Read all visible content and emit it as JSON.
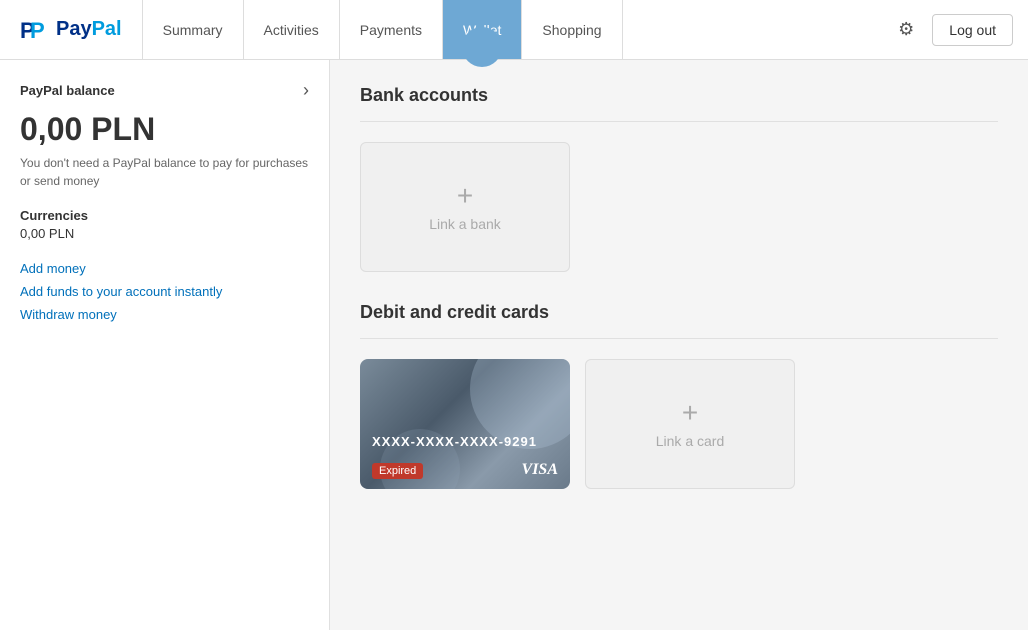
{
  "header": {
    "logo_text": "PayPal",
    "nav": [
      {
        "id": "summary",
        "label": "Summary",
        "active": false
      },
      {
        "id": "activities",
        "label": "Activities",
        "active": false
      },
      {
        "id": "payments",
        "label": "Payments",
        "active": false
      },
      {
        "id": "wallet",
        "label": "Wallet",
        "active": true
      },
      {
        "id": "shopping",
        "label": "Shopping",
        "active": false
      }
    ],
    "logout_label": "Log out"
  },
  "sidebar": {
    "balance_title": "PayPal balance",
    "balance_amount": "0,00 PLN",
    "balance_note": "You don't need a PayPal balance to pay for purchases or send money",
    "currencies_title": "Currencies",
    "currencies_value": "0,00 PLN",
    "links": [
      {
        "id": "add-money",
        "label": "Add money"
      },
      {
        "id": "add-funds",
        "label": "Add funds to your account instantly"
      },
      {
        "id": "withdraw",
        "label": "Withdraw money"
      }
    ]
  },
  "content": {
    "bank_section_title": "Bank accounts",
    "link_bank_label": "Link a bank",
    "debit_section_title": "Debit and credit cards",
    "card_number": "XXXX-XXXX-XXXX-9291",
    "card_expired_label": "Expired",
    "card_brand": "VISA",
    "link_card_label": "Link a card"
  },
  "icons": {
    "gear": "⚙",
    "chevron_right": "›",
    "plus": "+"
  }
}
